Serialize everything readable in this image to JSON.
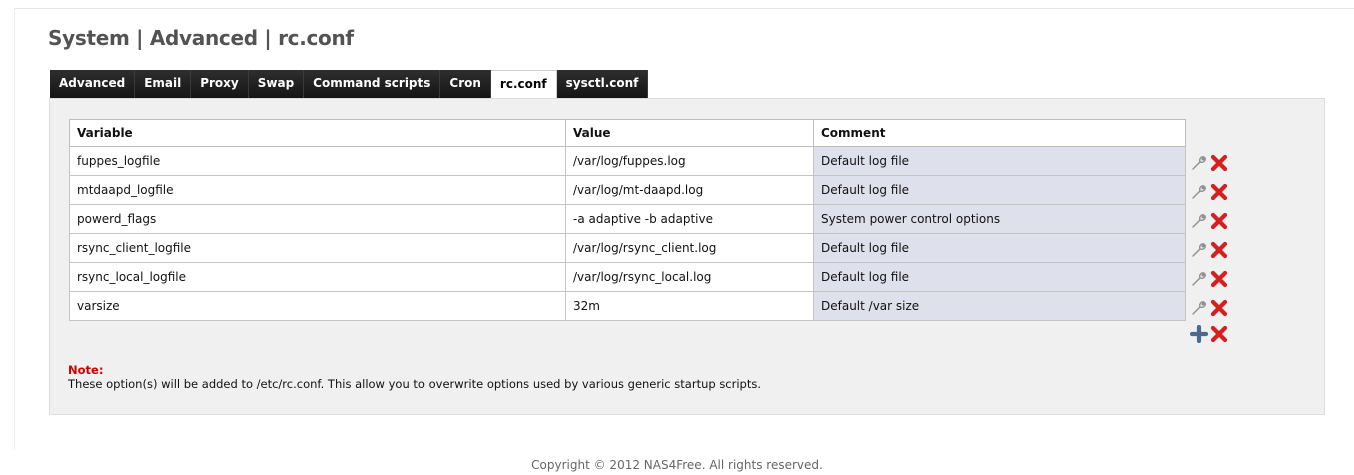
{
  "page": {
    "title": "System | Advanced | rc.conf"
  },
  "tabs": [
    {
      "label": "Advanced",
      "active": false
    },
    {
      "label": "Email",
      "active": false
    },
    {
      "label": "Proxy",
      "active": false
    },
    {
      "label": "Swap",
      "active": false
    },
    {
      "label": "Command scripts",
      "active": false
    },
    {
      "label": "Cron",
      "active": false
    },
    {
      "label": "rc.conf",
      "active": true
    },
    {
      "label": "sysctl.conf",
      "active": false
    }
  ],
  "table": {
    "headers": [
      "Variable",
      "Value",
      "Comment"
    ],
    "rows": [
      {
        "variable": "fuppes_logfile",
        "value": "/var/log/fuppes.log",
        "comment": "Default log file"
      },
      {
        "variable": "mtdaapd_logfile",
        "value": "/var/log/mt-daapd.log",
        "comment": "Default log file"
      },
      {
        "variable": "powerd_flags",
        "value": "-a adaptive -b adaptive",
        "comment": "System power control options"
      },
      {
        "variable": "rsync_client_logfile",
        "value": "/var/log/rsync_client.log",
        "comment": "Default log file"
      },
      {
        "variable": "rsync_local_logfile",
        "value": "/var/log/rsync_local.log",
        "comment": "Default log file"
      },
      {
        "variable": "varsize",
        "value": "32m",
        "comment": "Default /var size"
      }
    ]
  },
  "row_actions": {
    "edit_icon": "wrench-icon",
    "delete_icon": "delete-x-icon",
    "add_icon": "plus-icon"
  },
  "note": {
    "label": "Note:",
    "text": "These option(s) will be added to /etc/rc.conf. This allow you to overwrite options used by various generic startup scripts."
  },
  "footer": {
    "copyright": "Copyright © 2012 NAS4Free. All rights reserved."
  },
  "colors": {
    "tab_bg": "#222222",
    "note_label": "#d00000",
    "comment_cell_bg": "#dee0ec",
    "delete_red": "#d42020",
    "add_blue": "#4d6a8c"
  }
}
